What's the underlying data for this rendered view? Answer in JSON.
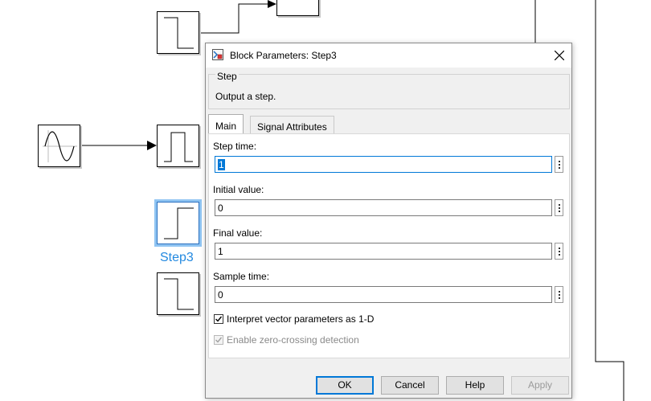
{
  "diagram": {
    "selected_block_label": "Step3"
  },
  "dialog": {
    "title": "Block Parameters: Step3",
    "group_title": "Step",
    "description": "Output a step.",
    "tabs": [
      {
        "label": "Main",
        "active": true
      },
      {
        "label": "Signal Attributes",
        "active": false
      }
    ],
    "fields": {
      "step_time": {
        "label": "Step time:",
        "value": "1"
      },
      "initial_value": {
        "label": "Initial value:",
        "value": "0"
      },
      "final_value": {
        "label": "Final value:",
        "value": "1"
      },
      "sample_time": {
        "label": "Sample time:",
        "value": "0"
      }
    },
    "checkboxes": {
      "interpret_vector": {
        "label": "Interpret vector parameters as 1-D",
        "checked": true,
        "enabled": true
      },
      "zero_crossing": {
        "label": "Enable zero-crossing detection",
        "checked": true,
        "enabled": false
      }
    },
    "buttons": {
      "ok": "OK",
      "cancel": "Cancel",
      "help": "Help",
      "apply": "Apply"
    }
  }
}
